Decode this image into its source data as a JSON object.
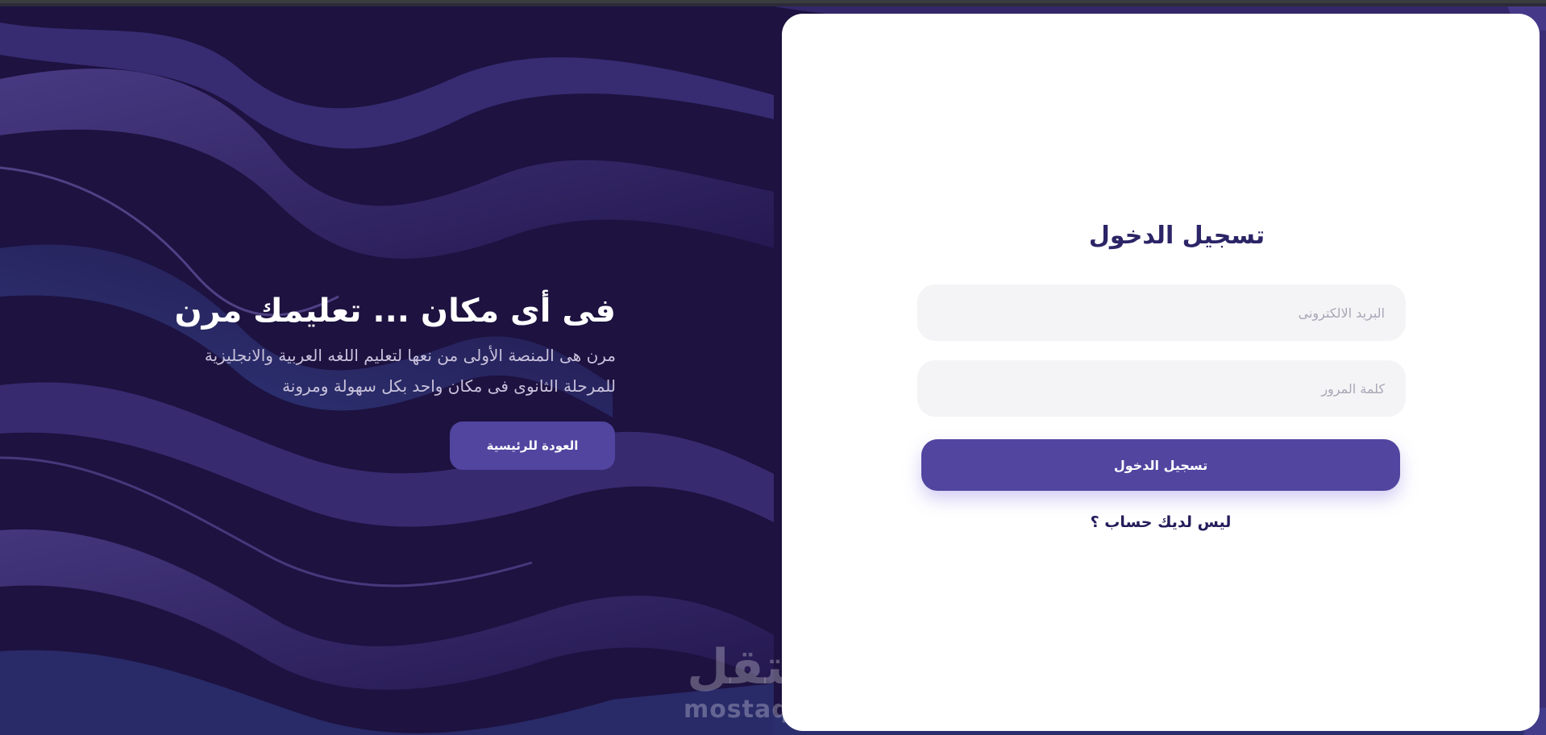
{
  "colors": {
    "background_dark": "#1d1240",
    "wave_purple": "#5a4aa8",
    "accent_button": "#5145a0",
    "card_background": "#ffffff",
    "field_background": "#f4f4f6",
    "title_color": "#2b2466"
  },
  "hero": {
    "title": "فى أى مكان ... تعليمك مرن",
    "description_line1": "مرن هى المنصة الأولى من نعها لتعليم اللغه العربية والانجليزية",
    "description_line2": "للمرحلة الثانوى فى مكان واحد بكل سهولة ومرونة",
    "back_button_label": "العودة للرئيسية"
  },
  "login": {
    "title": "تسجيل الدخول",
    "email_placeholder": "البريد الالكترونى",
    "password_placeholder": "كلمة المرور",
    "submit_label": "تسجيل الدخول",
    "signup_link": "ليس لديك حساب ؟"
  },
  "watermark": {
    "arabic": "مستقل",
    "latin": "mostaql.com"
  }
}
